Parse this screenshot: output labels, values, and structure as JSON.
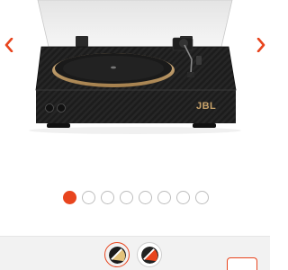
{
  "gallery": {
    "product_name": "",
    "brand_badge": "JBL",
    "image_count": 8,
    "active_index": 0,
    "prev_icon": "chevron-left-icon",
    "next_icon": "chevron-right-icon"
  },
  "colors": {
    "accent": "#e8451e",
    "dot_inactive": "#bdbdbd",
    "options_bar": "#f2f2f2"
  },
  "color_options": [
    {
      "name": "black-gold",
      "selected": true
    },
    {
      "name": "black-orange",
      "selected": false
    }
  ]
}
